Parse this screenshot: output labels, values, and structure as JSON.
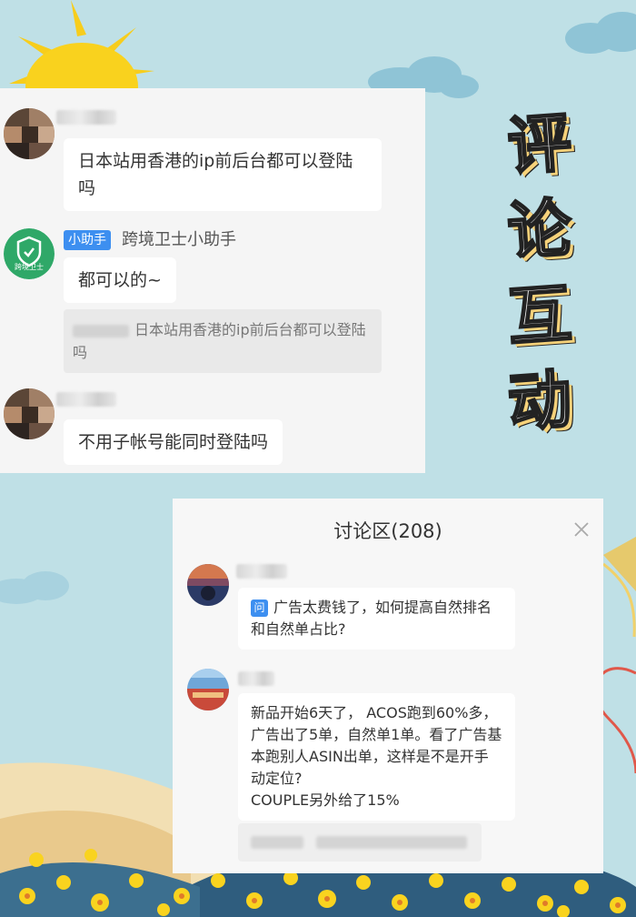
{
  "colors": {
    "sky": "#bfe0e6",
    "badge_blue": "#3d8ff0",
    "bubble_bg": "#ffffff",
    "panel_bg": "#f5f5f5",
    "flower_yellow": "#f9d31f",
    "title_shadow": "#f6d27a"
  },
  "chat": {
    "messages": [
      {
        "text": "日本站用香港的ip前后台都可以登陆吗"
      },
      {
        "badge": "小助手",
        "sender": "跨境卫士小助手",
        "avatar_label": "跨境卫士",
        "text": "都可以的~",
        "quote": "日本站用香港的ip前后台都可以登陆吗"
      },
      {
        "text": "不用子帐号能同时登陆吗"
      }
    ]
  },
  "side_title": [
    "评",
    "论",
    "互",
    "动"
  ],
  "discussion": {
    "title": "讨论区(208)",
    "items": [
      {
        "icon_label": "问",
        "text": "广告太费钱了，如何提高自然排名和自然单占比?"
      },
      {
        "text": "新品开始6天了， ACOS跑到60%多，广告出了5单，自然单1单。看了广告基本跑别人ASIN出单，这样是不是开手动定位?\nCOUPLE另外给了15%"
      }
    ]
  }
}
